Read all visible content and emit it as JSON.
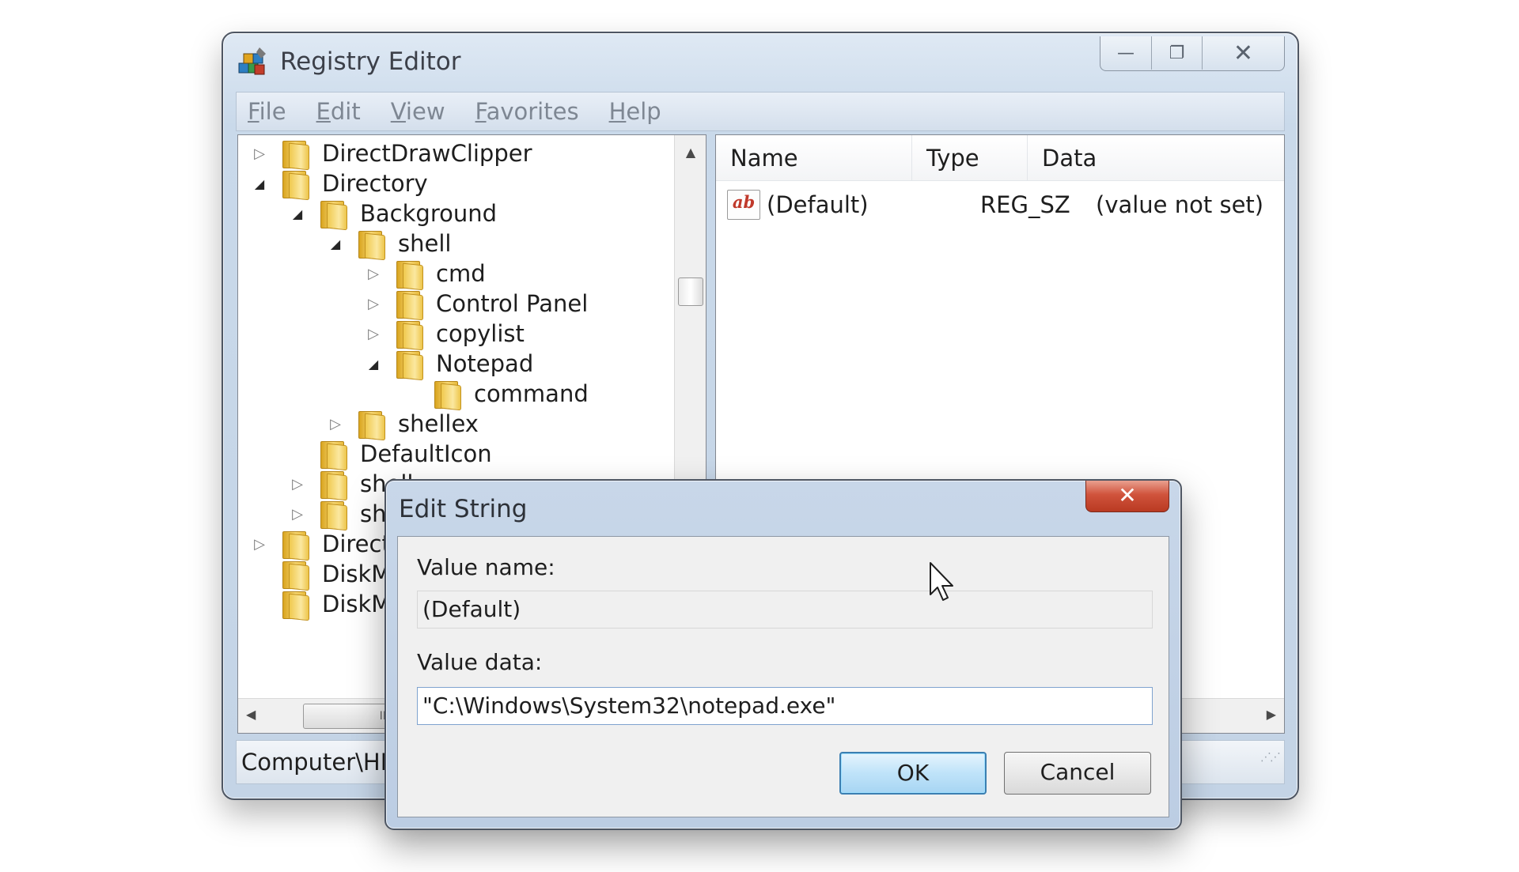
{
  "window": {
    "title": "Registry Editor",
    "controls": {
      "minimize": "—",
      "maximize": "❐",
      "close": "✕"
    }
  },
  "menu": [
    "File",
    "Edit",
    "View",
    "Favorites",
    "Help"
  ],
  "tree": [
    {
      "label": "DirectDrawClipper",
      "expander": "▷"
    },
    {
      "label": "Directory",
      "expander": "◢"
    },
    {
      "label": "Background",
      "expander": "◢"
    },
    {
      "label": "shell",
      "expander": "◢"
    },
    {
      "label": "cmd",
      "expander": "▷"
    },
    {
      "label": "Control Panel",
      "expander": "▷"
    },
    {
      "label": "copylist",
      "expander": "▷"
    },
    {
      "label": "Notepad",
      "expander": "◢"
    },
    {
      "label": "command",
      "expander": ""
    },
    {
      "label": "shellex",
      "expander": "▷"
    },
    {
      "label": "DefaultIcon",
      "expander": ""
    },
    {
      "label": "shell",
      "expander": "▷"
    },
    {
      "label": "shellex",
      "expander": "▷"
    },
    {
      "label": "DirectShow",
      "expander": "▷"
    },
    {
      "label": "DiskManagement",
      "expander": ""
    },
    {
      "label": "DiskManagement.Connection",
      "expander": ""
    }
  ],
  "list": {
    "columns": [
      "Name",
      "Type",
      "Data"
    ],
    "rows": [
      {
        "icon": "ab",
        "name": "(Default)",
        "type": "REG_SZ",
        "data": "(value not set)"
      }
    ]
  },
  "hscroll_grip": "III",
  "status": "Computer\\HKEY_CLASSES_ROOT\\Directory\\Background\\shell\\Notepad\\command",
  "dialog": {
    "title": "Edit String",
    "close": "✕",
    "value_name_label": "Value name:",
    "value_name": "(Default)",
    "value_data_label": "Value data:",
    "value_data": "\"C:\\Windows\\System32\\notepad.exe\"",
    "ok": "OK",
    "cancel": "Cancel"
  }
}
